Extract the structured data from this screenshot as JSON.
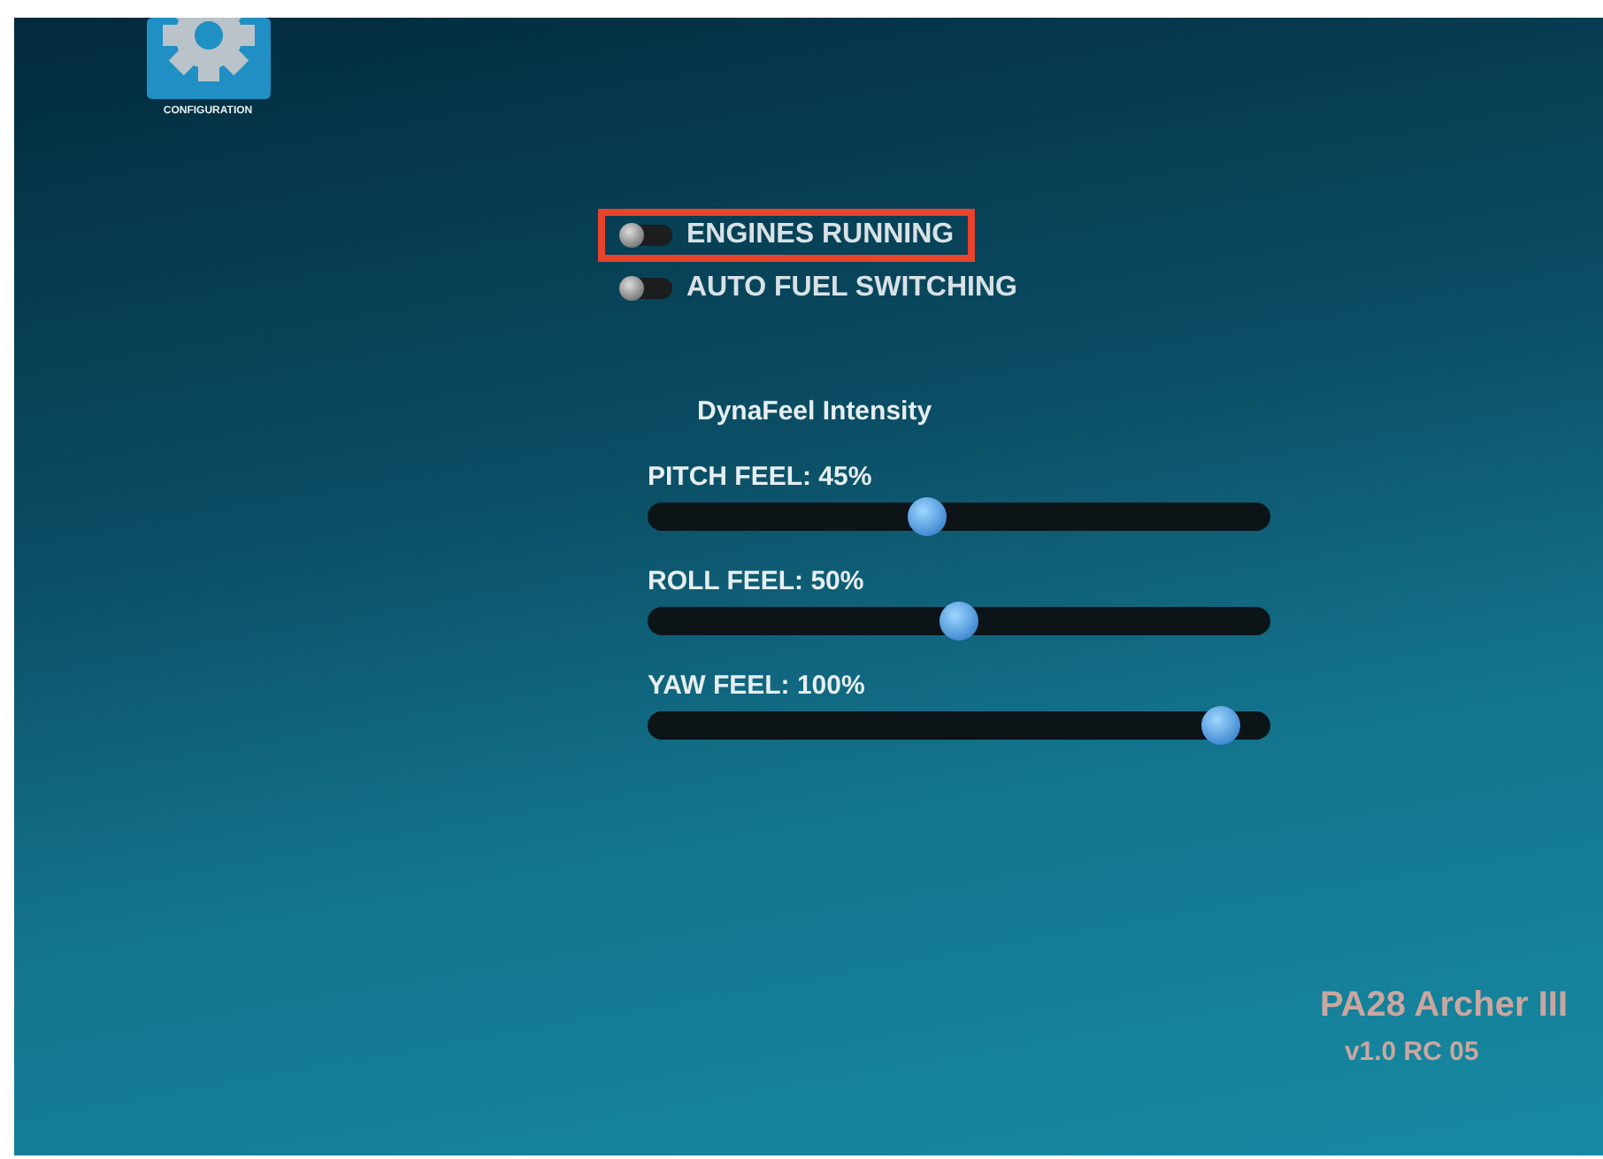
{
  "app_icon": {
    "label": "CONFIGURATION"
  },
  "toggles": [
    {
      "label": "ENGINES RUNNING",
      "on": false,
      "highlighted": true
    },
    {
      "label": "AUTO FUEL SWITCHING",
      "on": false,
      "highlighted": false
    }
  ],
  "dynafeel": {
    "title": "DynaFeel Intensity",
    "sliders": [
      {
        "label": "PITCH FEEL: 45%",
        "level": 0.45
      },
      {
        "label": "ROLL FEEL: 50%",
        "level": 0.5
      },
      {
        "label": "YAW FEEL: 100%",
        "level": 1
      }
    ]
  },
  "footer": {
    "aircraft": "PA28 Archer III",
    "version": "v1.0 RC 05"
  }
}
